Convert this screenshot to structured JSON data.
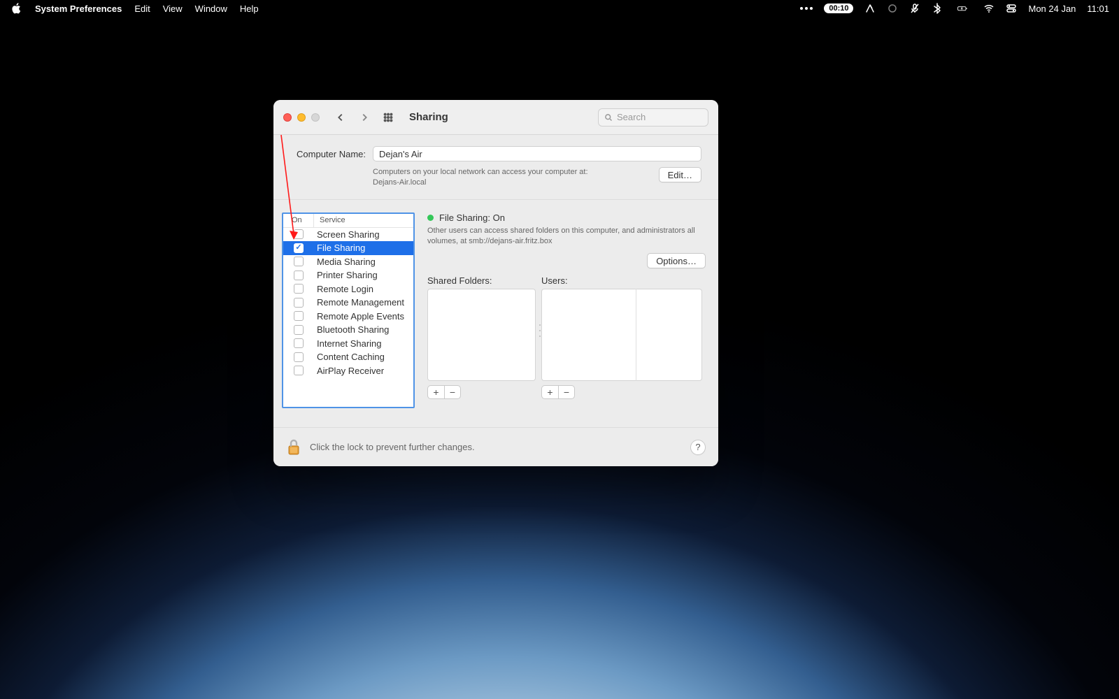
{
  "menubar": {
    "app": "System Preferences",
    "items": [
      "Edit",
      "View",
      "Window",
      "Help"
    ],
    "right": {
      "timer_pill": "00:10",
      "date": "Mon 24 Jan",
      "time": "11:01"
    }
  },
  "window": {
    "title": "Sharing",
    "search_placeholder": "Search",
    "nav": {
      "back_enabled": true,
      "forward_enabled": false
    }
  },
  "computer_name": {
    "label": "Computer Name:",
    "value": "Dejan's Air",
    "desc_line1": "Computers on your local network can access your computer at:",
    "desc_line2": "Dejans-Air.local",
    "edit_label": "Edit…"
  },
  "services": {
    "col_on": "On",
    "col_service": "Service",
    "items": [
      {
        "name": "Screen Sharing",
        "on": false,
        "selected": false
      },
      {
        "name": "File Sharing",
        "on": true,
        "selected": true
      },
      {
        "name": "Media Sharing",
        "on": false,
        "selected": false
      },
      {
        "name": "Printer Sharing",
        "on": false,
        "selected": false
      },
      {
        "name": "Remote Login",
        "on": false,
        "selected": false
      },
      {
        "name": "Remote Management",
        "on": false,
        "selected": false
      },
      {
        "name": "Remote Apple Events",
        "on": false,
        "selected": false
      },
      {
        "name": "Bluetooth Sharing",
        "on": false,
        "selected": false
      },
      {
        "name": "Internet Sharing",
        "on": false,
        "selected": false
      },
      {
        "name": "Content Caching",
        "on": false,
        "selected": false
      },
      {
        "name": "AirPlay Receiver",
        "on": false,
        "selected": false
      }
    ]
  },
  "status": {
    "title": "File Sharing: On",
    "desc": "Other users can access shared folders on this computer, and administrators all volumes, at smb://dejans-air.fritz.box",
    "options_label": "Options…"
  },
  "panels": {
    "shared_folders_label": "Shared Folders:",
    "users_label": "Users:"
  },
  "footer": {
    "lock_text": "Click the lock to prevent further changes.",
    "help": "?"
  },
  "glyphs": {
    "plus": "+",
    "minus": "−"
  }
}
